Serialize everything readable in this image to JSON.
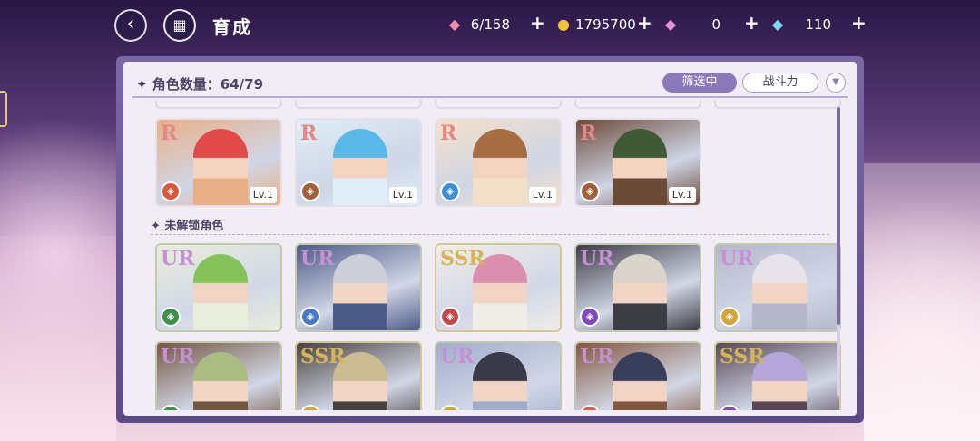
{
  "header": {
    "title": "育成",
    "resources": [
      {
        "icon": "candy-icon",
        "value": "6/158"
      },
      {
        "icon": "gold-coin-icon",
        "value": "1795700"
      },
      {
        "icon": "pink-gem-icon",
        "value": "0"
      },
      {
        "icon": "blue-diamond-icon",
        "value": "110"
      }
    ]
  },
  "panel": {
    "count_label": "✦ 角色数量：64/79",
    "filter_label": "筛选中",
    "power_label": "战斗力",
    "locked_section_label": "✦ 未解锁角色"
  },
  "owned_cards": [
    {
      "rarity": "R",
      "level": "Lv.1",
      "attr_color": "#d9573a",
      "palette": [
        "#e24a4a",
        "#e9b088"
      ]
    },
    {
      "rarity": "R",
      "level": "Lv.1",
      "attr_color": "#a0603a",
      "palette": [
        "#59b8e8",
        "#dfeef8"
      ]
    },
    {
      "rarity": "R",
      "level": "Lv.1",
      "attr_color": "#3b8fd8",
      "palette": [
        "#a66c42",
        "#f4e0c8"
      ]
    },
    {
      "rarity": "R",
      "level": "Lv.1",
      "attr_color": "#a0603a",
      "palette": [
        "#3f5a34",
        "#6b4a38"
      ]
    }
  ],
  "locked_cards": [
    {
      "rarity": "UR",
      "attr_color": "#2f8a3c",
      "palette": [
        "#7cbf4c",
        "#e9eedb"
      ]
    },
    {
      "rarity": "UR",
      "attr_color": "#3b6fc0",
      "palette": [
        "#c9ccd8",
        "#3f4e7e"
      ]
    },
    {
      "rarity": "SSR",
      "attr_color": "#c03c3c",
      "palette": [
        "#d888a8",
        "#f0eee8"
      ]
    },
    {
      "rarity": "UR",
      "attr_color": "#7a3cb8",
      "palette": [
        "#d9d4c8",
        "#2d2d36"
      ]
    },
    {
      "rarity": "UR",
      "attr_color": "#d0a02c",
      "palette": [
        "#e8e2ea",
        "#b0b4c8"
      ]
    },
    {
      "rarity": "UR",
      "attr_color": "#2f8a3c",
      "palette": [
        "#a4b878",
        "#6a4a34"
      ]
    },
    {
      "rarity": "SSR",
      "attr_color": "#d0a02c",
      "palette": [
        "#c8b88a",
        "#3a3430"
      ]
    },
    {
      "rarity": "UR",
      "attr_color": "#d0a02c",
      "palette": [
        "#2a2a3a",
        "#9aa8c8"
      ]
    },
    {
      "rarity": "UR",
      "attr_color": "#d9573a",
      "palette": [
        "#2a3050",
        "#7a4a30"
      ]
    },
    {
      "rarity": "SSR",
      "attr_color": "#7a3cb8",
      "palette": [
        "#b0a0d8",
        "#4a3a4a"
      ]
    }
  ]
}
